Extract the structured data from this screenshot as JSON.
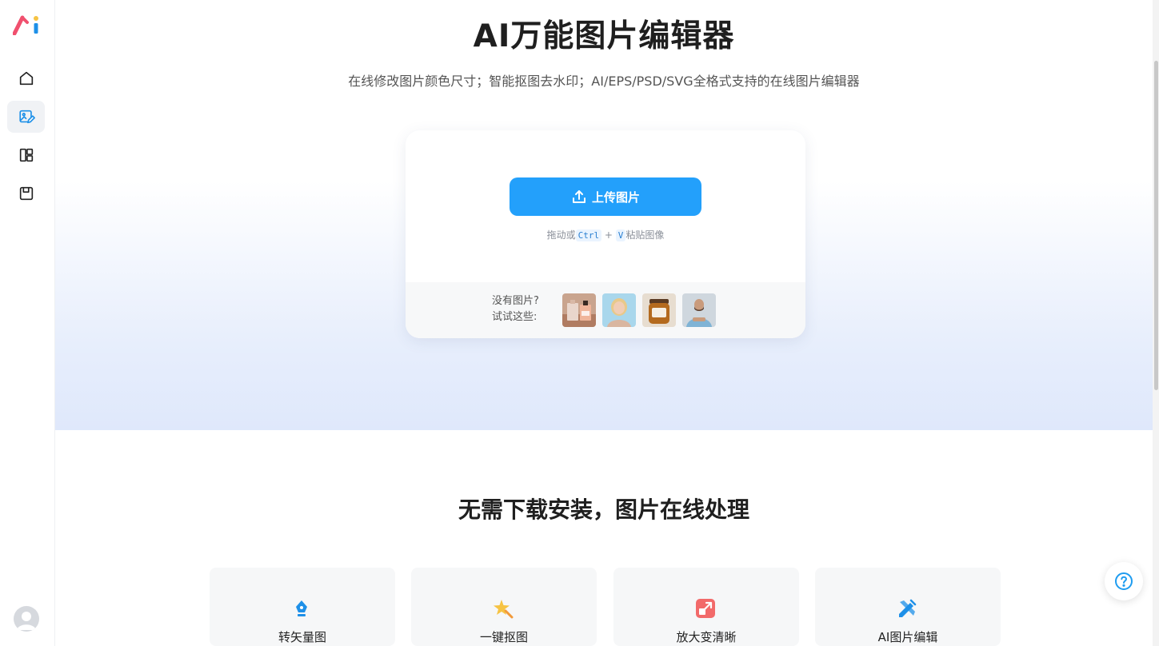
{
  "sidebar": {
    "items": [
      {
        "name": "home",
        "icon": "home-icon",
        "active": false
      },
      {
        "name": "image-editor",
        "icon": "image-edit-icon",
        "active": true
      },
      {
        "name": "templates",
        "icon": "layout-icon",
        "active": false
      },
      {
        "name": "saved",
        "icon": "save-icon",
        "active": false
      }
    ],
    "logo_icon": "ai-logo-icon",
    "avatar_icon": "user-avatar-icon"
  },
  "hero": {
    "title": "AI万能图片编辑器",
    "subtitle": "在线修改图片颜色尺寸；智能抠图去水印；AI/EPS/PSD/SVG全格式支持的在线图片编辑器"
  },
  "upload": {
    "button_label": "上传图片",
    "hint_prefix": "拖动或",
    "hint_key1": "Ctrl",
    "hint_plus": "+",
    "hint_key2": "V",
    "hint_suffix": "粘贴图像",
    "samples_line1": "没有图片?",
    "samples_line2": "试试这些:"
  },
  "section2": {
    "title": "无需下载安装，图片在线处理"
  },
  "features": [
    {
      "label": "转矢量图",
      "icon": "pen-tool-icon",
      "color": "#1e90e8"
    },
    {
      "label": "一键抠图",
      "icon": "magic-star-icon",
      "color": "#f6c343"
    },
    {
      "label": "放大变清晰",
      "icon": "enlarge-icon",
      "color": "#f26a6a"
    },
    {
      "label": "AI图片编辑",
      "icon": "edit-tools-icon",
      "color": "#1e90e8"
    }
  ],
  "help": {
    "icon": "help-icon"
  },
  "colors": {
    "accent": "#23a0fb",
    "help": "#1e9cf0"
  }
}
